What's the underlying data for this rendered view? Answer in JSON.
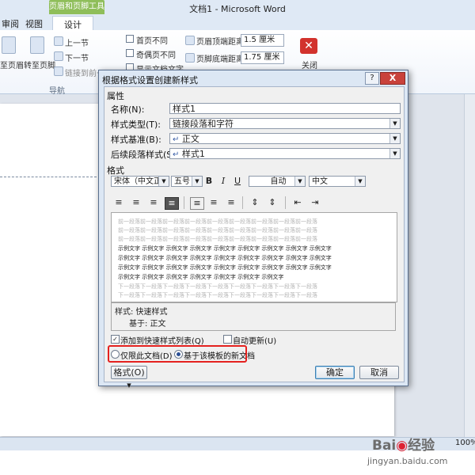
{
  "window": {
    "title": "文档1 - Microsoft Word",
    "context_tab_header": "页眉和页脚工具",
    "tabs": [
      "审阅",
      "视图",
      "设计"
    ]
  },
  "ribbon": {
    "btn_to_header": "至页眉",
    "btn_to_footer": "转至页脚",
    "prev_section": "上一节",
    "next_section": "下一节",
    "link_previous": "链接到前一",
    "nav_group": "导航",
    "options": {
      "first_page_diff": "首页不同",
      "odd_even_diff": "奇偶页不同",
      "show_doc_text": "显示文档文字"
    },
    "header_top_label": "页眉顶端距离:",
    "header_top_value": "1.5 厘米",
    "footer_bottom_label": "页脚底端距离:",
    "footer_bottom_value": "1.75 厘米",
    "close_label": "关闭"
  },
  "dialog": {
    "title": "根据格式设置创建新样式",
    "help": "?",
    "close": "X",
    "properties_section": "属性",
    "name_label": "名称(N):",
    "name_value": "样式1",
    "type_label": "样式类型(T):",
    "type_value": "链接段落和字符",
    "based_on_label": "样式基准(B):",
    "based_on_value": "正文",
    "next_style_label": "后续段落样式(S):",
    "next_style_value": "样式1",
    "format_section": "格式",
    "font_value": "宋体（中文正文",
    "size_value": "五号",
    "bold": "B",
    "italic": "I",
    "underline": "U",
    "color_value": "自动",
    "lang_value": "中文",
    "preview": {
      "prev_para": "前一段落前一段落前一段落前一段落前一段落前一段落前一段落前一段落前一段落",
      "sample": "示例文字 示例文字 示例文字 示例文字 示例文字 示例文字 示例文字 示例文字 示例文字",
      "sample_last": "示例文字 示例文字 示例文字 示例文字 示例文字 示例文字 示例文字",
      "next_para": "下一段落下一段落下一段落下一段落下一段落下一段落下一段落下一段落下一段落"
    },
    "description_line1": "样式: 快速样式",
    "description_line2": "基于: 正文",
    "add_quick_style": "添加到快速样式列表(Q)",
    "auto_update": "自动更新(U)",
    "radio_this_doc": "仅限此文档(D)",
    "radio_template": "基于该模板的新文档",
    "format_btn": "格式(O) ▾",
    "ok": "确定",
    "cancel": "取消"
  },
  "status": {
    "zoom": "100%"
  },
  "watermark": {
    "brand": "Bai",
    "brand2": "经验",
    "url": "jingyan.baidu.com"
  },
  "colors": {
    "highlight_box": "#e4211f",
    "context_tab": "#8fbe5a",
    "close_button": "#d2322d"
  }
}
